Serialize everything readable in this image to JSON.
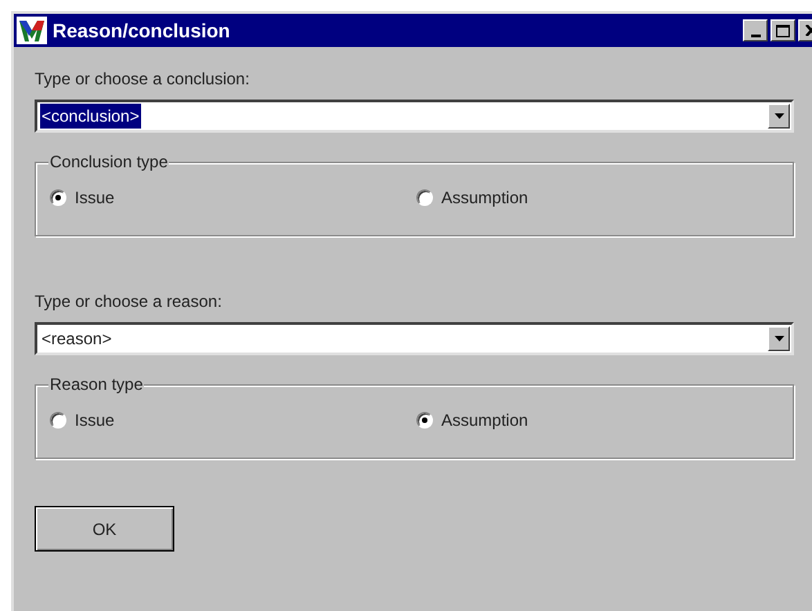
{
  "window": {
    "title": "Reason/conclusion"
  },
  "sections": [
    {
      "prompt": "Type or choose a conclusion:",
      "value": "<conclusion>",
      "value_highlighted": true,
      "group": {
        "title": "Conclusion type",
        "options": [
          {
            "label": "Issue",
            "selected": true
          },
          {
            "label": "Assumption",
            "selected": false
          }
        ]
      }
    },
    {
      "prompt": "Type or choose a reason:",
      "value": "<reason>",
      "value_highlighted": false,
      "group": {
        "title": "Reason type",
        "options": [
          {
            "label": "Issue",
            "selected": false
          },
          {
            "label": "Assumption",
            "selected": true
          }
        ]
      }
    }
  ],
  "buttons": [
    {
      "label": "OK"
    }
  ]
}
